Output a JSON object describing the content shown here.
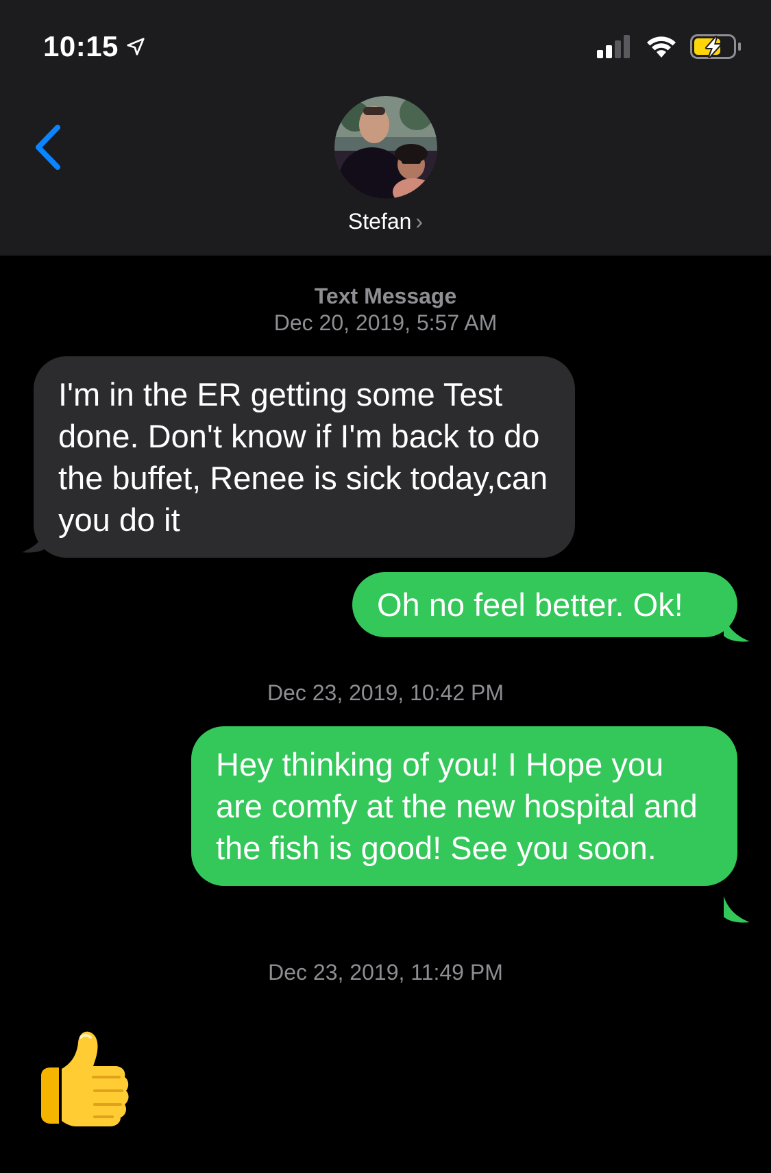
{
  "status_bar": {
    "time": "10:15",
    "location_icon": "location-arrow-icon",
    "signal_icon": "cellular-signal-icon",
    "wifi_icon": "wifi-icon",
    "battery_icon": "battery-charging-icon",
    "battery_color": "#ffd60a"
  },
  "nav": {
    "back_icon": "chevron-left-icon",
    "contact_name": "Stefan",
    "contact_chevron": "›",
    "accent": "#0a84ff"
  },
  "thread": {
    "service_label": "Text Message",
    "timestamp_1": "Dec 20, 2019, 5:57 AM",
    "msg_1": "I'm in the ER getting some Test done. Don't know if I'm back to do the buffet, Renee is sick today,can you do it",
    "msg_2": "Oh no feel better. Ok!",
    "timestamp_2": "Dec 23, 2019, 10:42 PM",
    "msg_3": "Hey thinking of you! I Hope you are comfy at the new hospital and the fish is good! See you soon.",
    "timestamp_3": "Dec 23, 2019, 11:49 PM",
    "msg_4_emoji": "thumbs-up-icon",
    "incoming_color": "#2c2c2e",
    "outgoing_color": "#34c759"
  }
}
